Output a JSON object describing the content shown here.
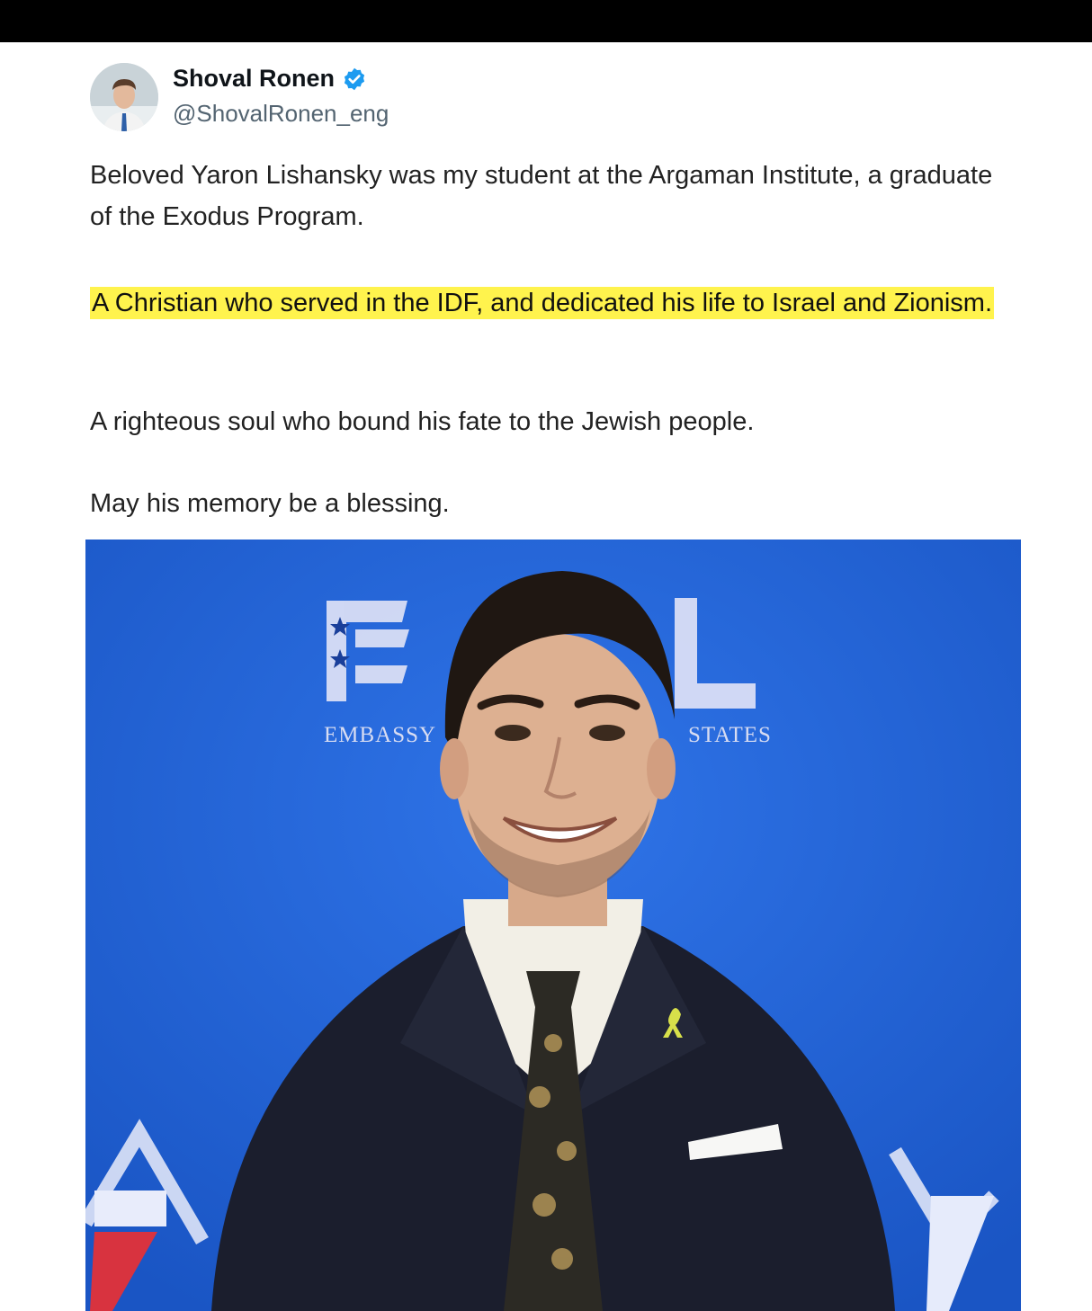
{
  "tweet": {
    "author": {
      "display_name": "Shoval Ronen",
      "handle": "@ShovalRonen_eng",
      "verified": true,
      "avatar_icon": "profile-photo"
    },
    "paragraphs": [
      "Beloved Yaron Lishansky was my student at the Argaman Institute, a graduate of the Exodus Program.",
      "A Christian who served in the IDF, and dedicated his life to Israel and Zionism.",
      "A righteous soul who bound his fate to the Jewish people.",
      "May his memory be a blessing."
    ],
    "highlight_color": "#fff34d",
    "photo": {
      "backdrop_color": "#1f5fd0",
      "backdrop_text_left": "EMBASSY",
      "backdrop_text_right": "STATES"
    }
  },
  "colors": {
    "verified_badge": "#1d9bf0",
    "handle_text": "#536471",
    "top_bar": "#000000"
  }
}
